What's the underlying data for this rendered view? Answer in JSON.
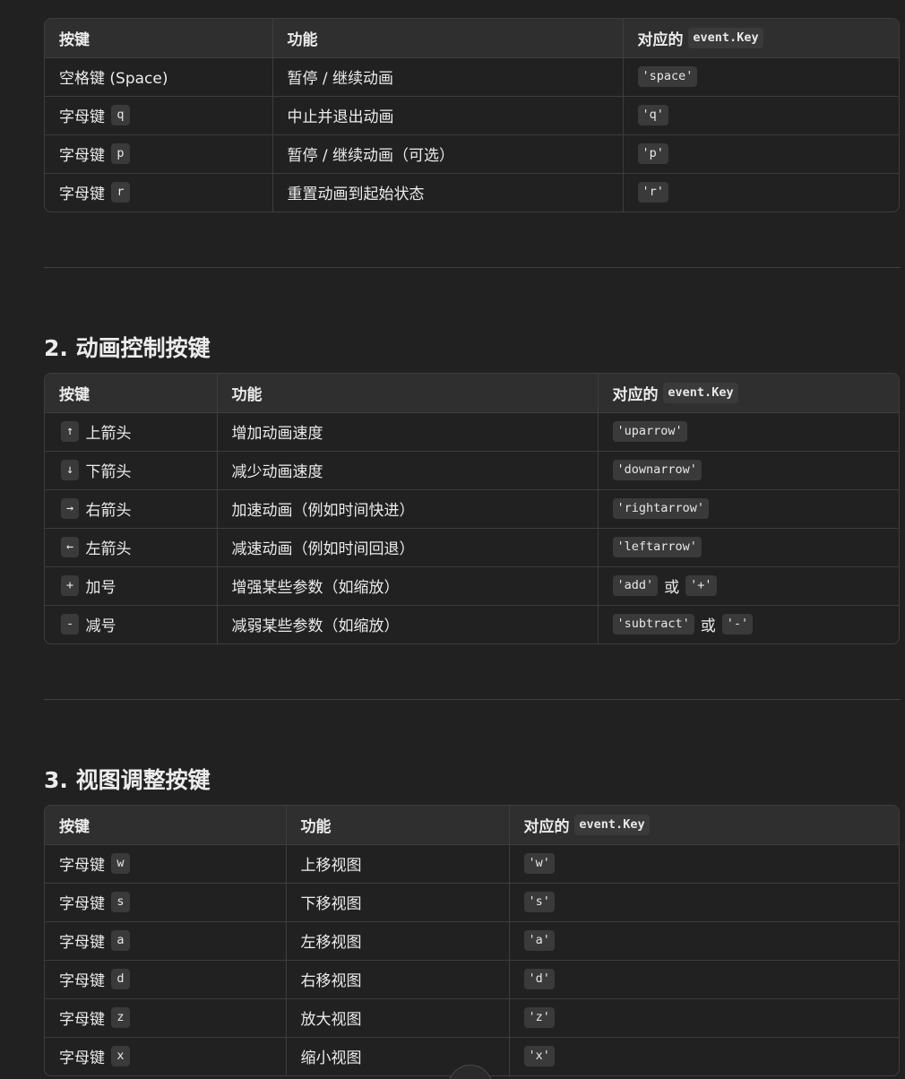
{
  "headers": {
    "key": "按键",
    "function": "功能",
    "event_prefix": "对应的",
    "event_code": "event.Key"
  },
  "table1": {
    "rows": [
      {
        "key_text": "空格键 (Space)",
        "key_code": "",
        "function": "暂停 / 继续动画",
        "event": [
          "'space'"
        ],
        "sep": ""
      },
      {
        "key_text": "字母键",
        "key_code": "q",
        "function": "中止并退出动画",
        "event": [
          "'q'"
        ],
        "sep": ""
      },
      {
        "key_text": "字母键",
        "key_code": "p",
        "function": "暂停 / 继续动画（可选）",
        "event": [
          "'p'"
        ],
        "sep": ""
      },
      {
        "key_text": "字母键",
        "key_code": "r",
        "function": "重置动画到起始状态",
        "event": [
          "'r'"
        ],
        "sep": ""
      }
    ]
  },
  "section2": {
    "title": "2. 动画控制按键",
    "rows": [
      {
        "key_code": "↑",
        "key_text": "上箭头",
        "function": "增加动画速度",
        "event": [
          "'uparrow'"
        ],
        "sep": ""
      },
      {
        "key_code": "↓",
        "key_text": "下箭头",
        "function": "减少动画速度",
        "event": [
          "'downarrow'"
        ],
        "sep": ""
      },
      {
        "key_code": "→",
        "key_text": "右箭头",
        "function": "加速动画（例如时间快进）",
        "event": [
          "'rightarrow'"
        ],
        "sep": ""
      },
      {
        "key_code": "←",
        "key_text": "左箭头",
        "function": "减速动画（例如时间回退）",
        "event": [
          "'leftarrow'"
        ],
        "sep": ""
      },
      {
        "key_code": "+",
        "key_text": "加号",
        "function": "增强某些参数（如缩放）",
        "event": [
          "'add'",
          "'+'"
        ],
        "sep": "或"
      },
      {
        "key_code": "-",
        "key_text": "减号",
        "function": "减弱某些参数（如缩放）",
        "event": [
          "'subtract'",
          "'-'"
        ],
        "sep": "或"
      }
    ]
  },
  "section3": {
    "title": "3. 视图调整按键",
    "rows": [
      {
        "key_text": "字母键",
        "key_code": "w",
        "function": "上移视图",
        "event": [
          "'w'"
        ],
        "sep": ""
      },
      {
        "key_text": "字母键",
        "key_code": "s",
        "function": "下移视图",
        "event": [
          "'s'"
        ],
        "sep": ""
      },
      {
        "key_text": "字母键",
        "key_code": "a",
        "function": "左移视图",
        "event": [
          "'a'"
        ],
        "sep": ""
      },
      {
        "key_text": "字母键",
        "key_code": "d",
        "function": "右移视图",
        "event": [
          "'d'"
        ],
        "sep": ""
      },
      {
        "key_text": "字母键",
        "key_code": "z",
        "function": "放大视图",
        "event": [
          "'z'"
        ],
        "sep": ""
      },
      {
        "key_text": "字母键",
        "key_code": "x",
        "function": "缩小视图",
        "event": [
          "'x'"
        ],
        "sep": ""
      }
    ]
  }
}
